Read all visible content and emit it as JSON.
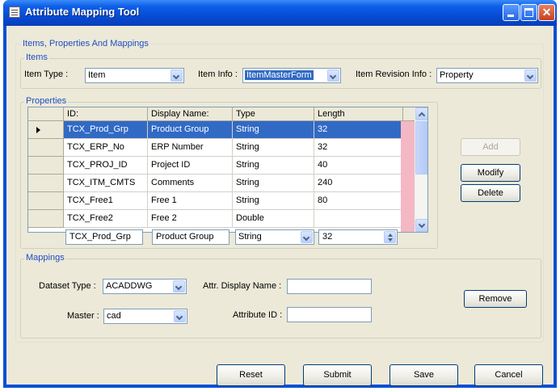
{
  "window": {
    "title": "Attribute Mapping Tool"
  },
  "outer_group": {
    "legend": "Items, Properties And Mappings"
  },
  "items_group": {
    "legend": "Items",
    "item_type_label": "Item Type :",
    "item_type_value": "Item",
    "item_info_label": "Item Info :",
    "item_info_value": "ItemMasterForm",
    "item_revision_label": "Item Revision Info :",
    "item_revision_value": "Property"
  },
  "properties_group": {
    "legend": "Properties",
    "columns": [
      "ID:",
      "Display Name:",
      "Type",
      "Length"
    ],
    "rows": [
      {
        "id": "TCX_Prod_Grp",
        "display_name": "Product Group",
        "type": "String",
        "length": "32"
      },
      {
        "id": "TCX_ERP_No",
        "display_name": "ERP Number",
        "type": "String",
        "length": "32"
      },
      {
        "id": "TCX_PROJ_ID",
        "display_name": "Project ID",
        "type": "String",
        "length": "40"
      },
      {
        "id": "TCX_ITM_CMTS",
        "display_name": "Comments",
        "type": "String",
        "length": "240"
      },
      {
        "id": "TCX_Free1",
        "display_name": "Free 1",
        "type": "String",
        "length": "80"
      },
      {
        "id": "TCX_Free2",
        "display_name": "Free 2",
        "type": "Double",
        "length": ""
      }
    ],
    "selected_row": 0,
    "edit": {
      "id": "TCX_Prod_Grp",
      "display_name": "Product Group",
      "type": "String",
      "length": "32"
    },
    "add_label": "Add",
    "modify_label": "Modify",
    "delete_label": "Delete"
  },
  "mappings_group": {
    "legend": "Mappings",
    "dataset_type_label": "Dataset Type :",
    "dataset_type_value": "ACADDWG",
    "master_label": "Master :",
    "master_value": "cad",
    "attr_display_name_label": "Attr. Display Name :",
    "attr_display_name_value": "",
    "attribute_id_label": "Attribute ID :",
    "attribute_id_value": "",
    "remove_label": "Remove"
  },
  "footer": {
    "reset_label": "Reset",
    "submit_label": "Submit",
    "save_label": "Save",
    "cancel_label": "Cancel"
  },
  "colors": {
    "titlebar": "#0a4fd6",
    "selection": "#316ac5",
    "legend_text": "#1f4ec4",
    "face": "#ece9d8",
    "pink_column": "#f4b8c4"
  }
}
